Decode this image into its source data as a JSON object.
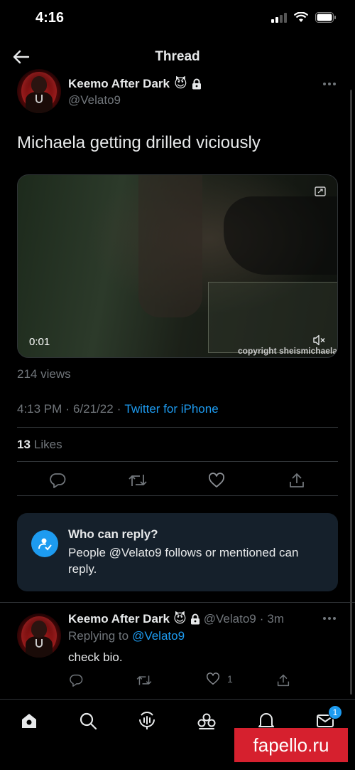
{
  "status_bar": {
    "time": "4:16"
  },
  "header": {
    "title": "Thread"
  },
  "tweet": {
    "display_name": "Keemo After Dark",
    "name_emoji": "😈",
    "handle": "@Velato9",
    "text": "Michaela getting drilled viciously",
    "video": {
      "elapsed": "0:01",
      "watermark": "copyright sheismichaela"
    },
    "views": "214 views",
    "time": "4:13 PM",
    "date": "6/21/22",
    "separator": "·",
    "source": "Twitter for iPhone",
    "likes_count": "13",
    "likes_label": "Likes"
  },
  "who_can_reply": {
    "title": "Who can reply?",
    "description": "People @Velato9 follows or mentioned can reply."
  },
  "reply": {
    "display_name": "Keemo After Dark",
    "name_emoji": "😈",
    "handle": "@Velato9",
    "time": "3m",
    "separator": "·",
    "replying_to_label": "Replying to",
    "replying_to_handle": "@Velato9",
    "text": "check bio.",
    "like_count": "1"
  },
  "bottom_nav": {
    "items": [
      "home-icon",
      "search-icon",
      "spaces-icon",
      "communities-icon",
      "notifications-icon",
      "messages-icon"
    ],
    "messages_badge": "1"
  },
  "site_watermark": "fapello.ru",
  "colors": {
    "background": "#000000",
    "text": "#e7e9ea",
    "muted": "#71767b",
    "accent": "#1d9bf0",
    "card": "#15202b"
  }
}
